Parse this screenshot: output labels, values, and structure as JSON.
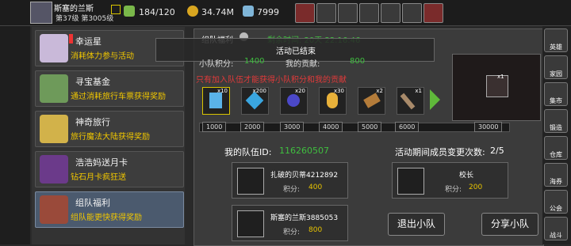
{
  "player": {
    "name": "斯塞的兰斯",
    "level_text": "第37级 第3005级",
    "level_small": "53"
  },
  "stats": {
    "stamina": "184/120",
    "gold": "34.74M",
    "gems": "7999"
  },
  "side_items": [
    {
      "title": "幸运星",
      "sub": "消耗体力参与活动"
    },
    {
      "title": "寻宝基金",
      "sub": "通过消耗旅行车票获得奖励"
    },
    {
      "title": "神奇旅行",
      "sub": "旅行魔法大陆获得奖励"
    },
    {
      "title": "浩浩妈送月卡",
      "sub": "钻石月卡疯狂送"
    },
    {
      "title": "组队福利",
      "sub": "组队能更快获得奖励"
    }
  ],
  "panel": {
    "title": "组队福利",
    "remaining": "剩余时间: 20天 22:16:46",
    "ended": "活动已结束",
    "team_points_label": "小队积分:",
    "team_points": "1400",
    "my_contrib_label": "我的贡献:",
    "my_contrib": "800",
    "notice": "只有加入队伍才能获得小队积分和我的贡献",
    "items": [
      {
        "count": "x10",
        "icon": "lightning-icon"
      },
      {
        "count": "x200",
        "icon": "gem-icon"
      },
      {
        "count": "x20",
        "icon": "purple-orb-icon"
      },
      {
        "count": "x30",
        "icon": "egg-icon"
      },
      {
        "count": "x2",
        "icon": "scroll-icon"
      },
      {
        "count": "x1",
        "icon": "hammer-icon"
      }
    ],
    "milestones": [
      "1000",
      "2000",
      "3000",
      "4000",
      "5000",
      "6000",
      "30000"
    ],
    "team_id_label": "我的队伍ID:",
    "team_id": "116260507",
    "changes_label": "活动期间成员变更次数:",
    "changes": "2/5",
    "members": [
      {
        "name": "扎破的贝蒂4212892",
        "points_label": "积分:",
        "points": "400"
      },
      {
        "name": "校长",
        "points_label": "积分:",
        "points": "200"
      },
      {
        "name": "斯塞的兰斯3885053",
        "points_label": "积分:",
        "points": "800"
      }
    ],
    "quit_btn": "退出小队",
    "share_btn": "分享小队",
    "reward_count": "x1"
  },
  "right_nav": [
    "英雄",
    "家园",
    "集市",
    "锻造",
    "仓库",
    "海券",
    "公会",
    "战斗"
  ]
}
